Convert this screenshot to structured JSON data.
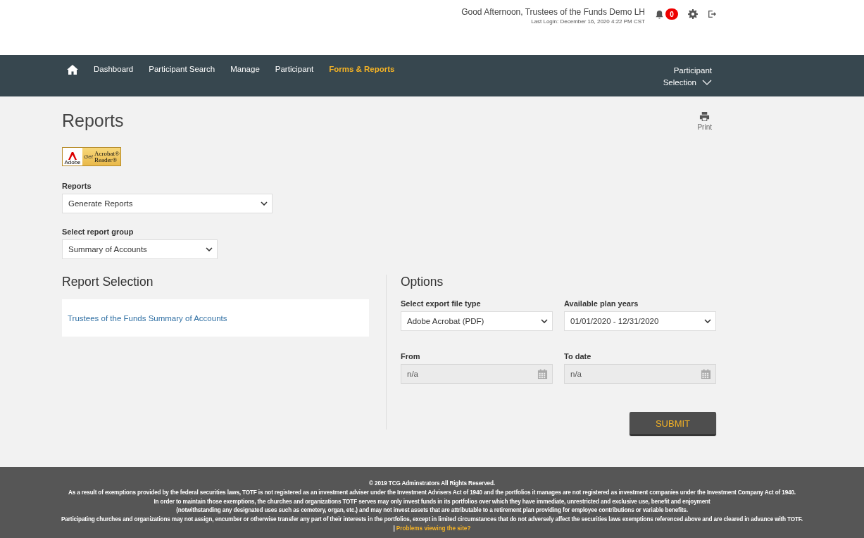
{
  "header": {
    "greeting": "Good Afternoon,  Trustees of the Funds Demo LH",
    "last_login": "Last Login: December 16, 2020 4:22 PM CST",
    "notification_count": "0"
  },
  "nav": {
    "items": [
      {
        "label": "Dashboard",
        "selected": false
      },
      {
        "label": "Participant Search",
        "selected": false
      },
      {
        "label": "Manage",
        "selected": false
      },
      {
        "label": "Participant",
        "selected": false
      },
      {
        "label": "Forms & Reports",
        "selected": true
      }
    ],
    "participant_selection": [
      "Participant",
      "Selection"
    ]
  },
  "page": {
    "title": "Reports",
    "print_label": "Print",
    "acrobat_badge": {
      "brand": "Adobe",
      "get": "Get",
      "product_line_1": "Acrobat®",
      "product_line_2": "Reader®"
    },
    "reports_field": {
      "label": "Reports",
      "value": "Generate Reports"
    },
    "report_group_field": {
      "label": "Select report group",
      "value": "Summary of Accounts"
    }
  },
  "report_selection": {
    "heading": "Report Selection",
    "items": [
      {
        "label": "Trustees of the Funds Summary of Accounts"
      }
    ]
  },
  "options": {
    "heading": "Options",
    "fields": [
      {
        "kind": "select",
        "label": "Select export file type",
        "value": "Adobe Acrobat (PDF)",
        "disabled": false
      },
      {
        "kind": "select",
        "label": "Available plan years",
        "value": "01/01/2020 - 12/31/2020",
        "disabled": false
      },
      {
        "kind": "date",
        "label": "From",
        "value": "n/a",
        "disabled": true
      },
      {
        "kind": "date",
        "label": "To date",
        "value": "n/a",
        "disabled": true
      }
    ],
    "submit": "SUBMIT"
  },
  "footer": {
    "copyright": "© 2019 TCG Adminstrators All Rights Reserved.",
    "lines": [
      "As a result of exemptions provided by the federal securities laws, TOTF is not registered as an investment adviser under the Investment Advisers Act of 1940 and the portfolios it manages are not registered as investment companies under the Investment Company Act of 1940.",
      "In order to maintain those exemptions, the churches and organizations TOTF serves may only invest funds in its portfolios over which they have immediate, unrestricted and exclusive use, benefit and enjoyment",
      "(notwithstanding any designated uses such as cemetery, organ, etc.) and may not invest assets that are attributable to a retirement plan providing for employee contributions or variable benefits.",
      "Participating churches and organizations may not assign, encumber or otherwise transfer any part of their interests in the portfolios, except in limited circumstances that do not adversely affect the securities laws exemptions referenced above and are cleared in advance with TOTF."
    ],
    "separator": "|",
    "link": "Problems viewing the site?"
  }
}
